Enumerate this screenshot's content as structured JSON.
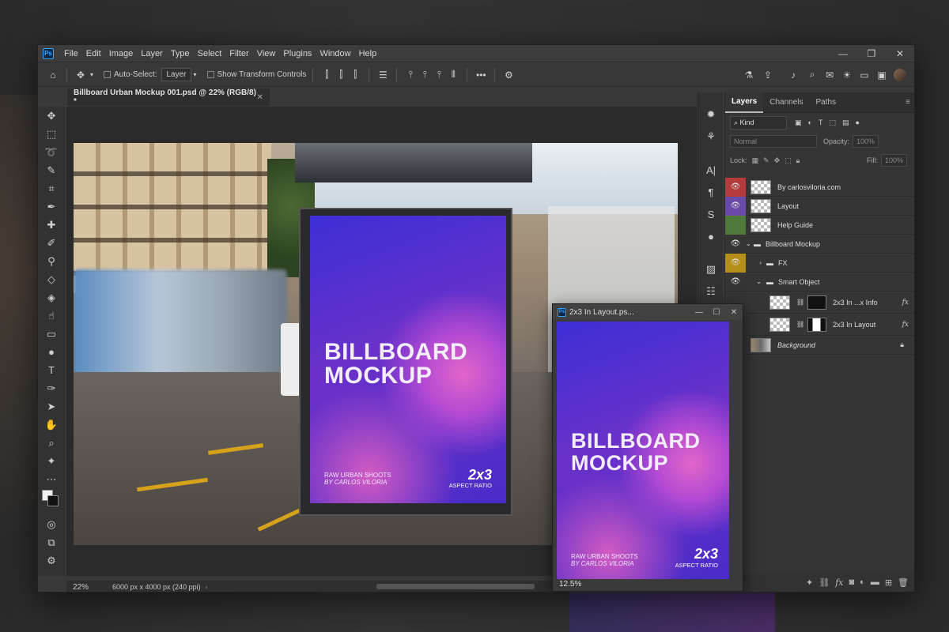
{
  "menu": [
    "File",
    "Edit",
    "Image",
    "Layer",
    "Type",
    "Select",
    "Filter",
    "View",
    "Plugins",
    "Window",
    "Help"
  ],
  "app_logo": "Ps",
  "options": {
    "auto_select_label": "Auto-Select:",
    "auto_select_value": "Layer",
    "transform_label": "Show Transform Controls",
    "more_label": "•••"
  },
  "document": {
    "tab_title": "Billboard Urban Mockup 001.psd @ 22% (RGB/8) *",
    "zoom": "22%",
    "info": "6000 px x 4000 px (240 ppi)"
  },
  "poster": {
    "title_line1": "BILLBOARD",
    "title_line2": "MOCKUP",
    "sub_line1": "RAW URBAN SHOOTS",
    "sub_line2": "BY CARLOS VILORIA",
    "ratio": "2x3",
    "ratio_label": "ASPECT RATIO"
  },
  "float_window": {
    "title": "2x3 In Layout.ps...",
    "zoom": "12.5%"
  },
  "panel": {
    "tabs": [
      "Layers",
      "Channels",
      "Paths"
    ],
    "kind_label": "Kind",
    "blend_mode": "Normal",
    "opacity_label": "Opacity:",
    "opacity_value": "100%",
    "lock_label": "Lock:",
    "fill_label": "Fill:",
    "fill_value": "100%",
    "layers": [
      {
        "name": "By carlosviloria.com",
        "color": "#b33b3b"
      },
      {
        "name": "Layout",
        "color": "#6a4aa8"
      },
      {
        "name": "Help Guide",
        "color": "#4f7a3a"
      },
      {
        "name": "Billboard Mockup"
      },
      {
        "name": "FX",
        "color": "#b58f1b"
      },
      {
        "name": "Smart Object"
      },
      {
        "name": "2x3 In ...x Info"
      },
      {
        "name": "2x3 In Layout"
      },
      {
        "name": "Background"
      }
    ]
  }
}
